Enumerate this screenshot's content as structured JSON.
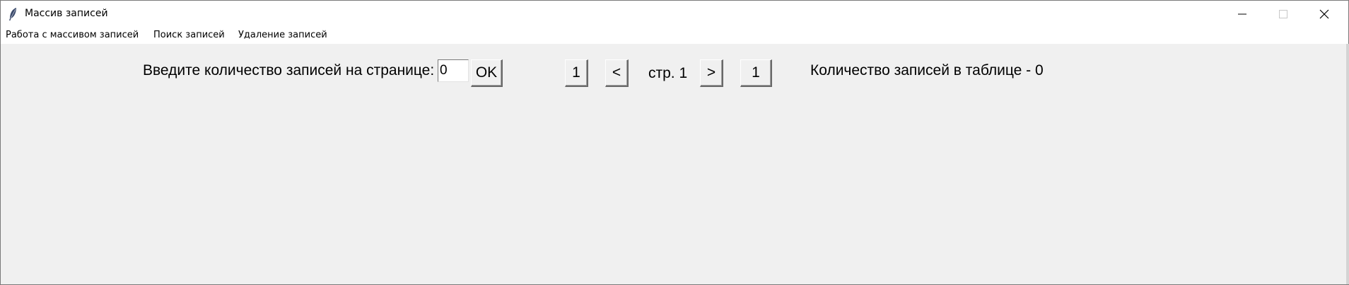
{
  "window": {
    "title": "Массив записей",
    "icon": "feather-icon",
    "controls": [
      "minimize-icon",
      "maximize-icon",
      "close-icon"
    ]
  },
  "menu": {
    "items": [
      {
        "label": "Работа с массивом записей"
      },
      {
        "label": "Поиск записей"
      },
      {
        "label": "Удаление записей"
      }
    ]
  },
  "toolbar": {
    "records_per_page_label": "Введите количество записей на странице:",
    "records_per_page_value": "0",
    "ok_label": "OK",
    "first_page_label": "1",
    "prev_label": "<",
    "page_label": "стр. 1",
    "next_label": ">",
    "last_page_label": "1",
    "total_records_label": "Количество записей в таблице - 0"
  }
}
